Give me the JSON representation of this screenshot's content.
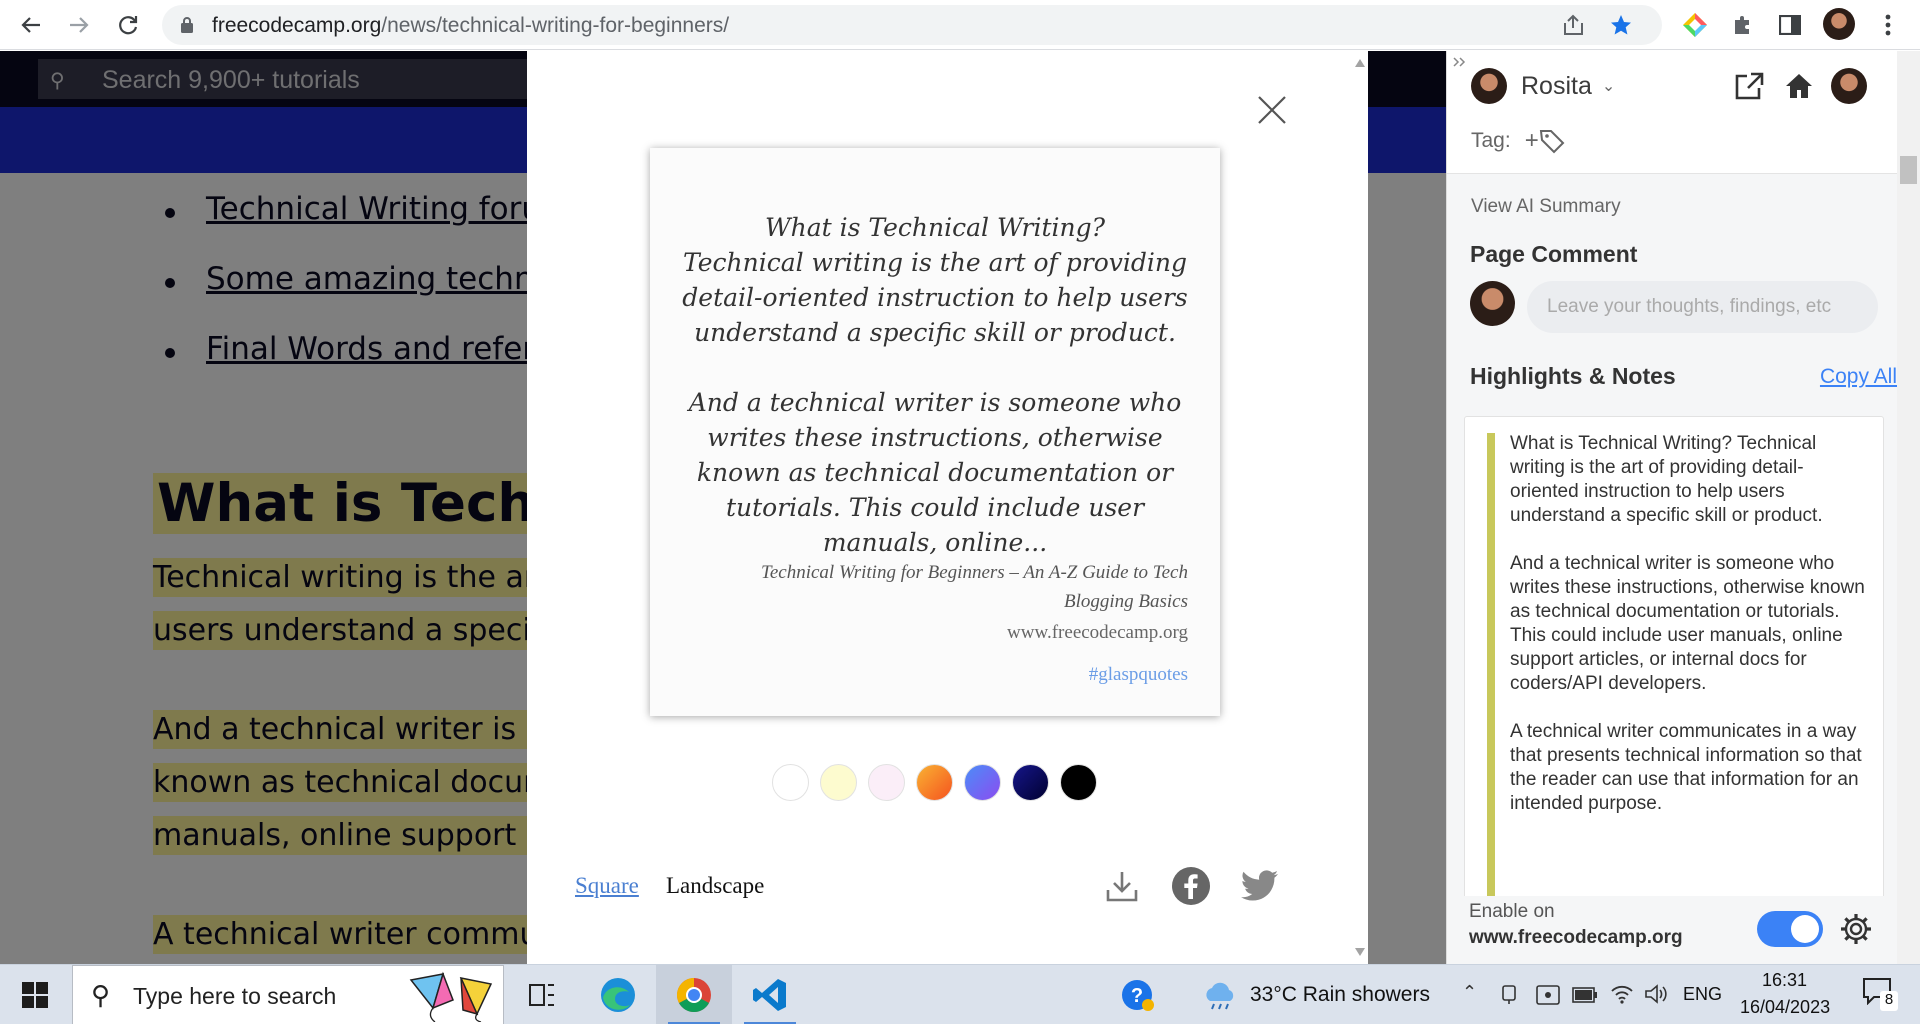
{
  "browser": {
    "url_domain": "freecodecamp.org",
    "url_path": "/news/technical-writing-for-beginners/"
  },
  "page": {
    "search_placeholder": "Search 9,900+ tutorials",
    "toc": [
      "Technical Writing foru",
      "Some amazing technica",
      "Final Words and refere"
    ],
    "heading": "What is Techni",
    "paragraphs": [
      [
        "Technical writing is the art",
        "users understand a specifi"
      ],
      [
        "And a technical writer is so",
        "known as technical docum",
        "manuals, online support ar"
      ],
      [
        "A technical writer commu"
      ]
    ]
  },
  "modal": {
    "quote_paragraphs": [
      "What is Technical Writing?\nTechnical writing is the art of providing detail-oriented instruction to help users understand a specific skill or product.",
      "And a technical writer is someone who writes these instructions, otherwise known as technical documentation or tutorials. This could include user manuals, online..."
    ],
    "source_title": "Technical Writing for Beginners – An A-Z Guide to Tech Blogging Basics",
    "source_site": "www.freecodecamp.org",
    "hashtag": "#glaspquotes",
    "swatches": [
      "#ffffff",
      "#fdfbcf",
      "#fbeef8",
      "#f98a2a",
      "#6a63ee",
      "#0b0b6b",
      "#000000"
    ],
    "format_square": "Square",
    "format_landscape": "Landscape"
  },
  "panel": {
    "user_name": "Rosita",
    "tag_label": "Tag:",
    "view_ai_summary": "View AI Summary",
    "page_comment_title": "Page Comment",
    "comment_placeholder": "Leave your thoughts, findings, etc",
    "highlights_title": "Highlights & Notes",
    "copy_all": "Copy All",
    "highlights": [
      "What is Technical Writing? Technical writing is the art of providing detail-oriented instruction to help users understand a specific skill or product.",
      "And a technical writer is someone who writes these instructions, otherwise known as technical documentation or tutorials. This could include user manuals, online support articles, or internal docs for coders/API developers.",
      "A technical writer communicates in a way that presents technical information so that the reader can use that information for an intended purpose."
    ],
    "enable_on": "Enable on",
    "enable_site": "www.freecodecamp.org"
  },
  "taskbar": {
    "search_text": "Type here to search",
    "weather": "33°C  Rain showers",
    "language": "ENG",
    "time": "16:31",
    "date": "16/04/2023",
    "notification_count": "8"
  }
}
